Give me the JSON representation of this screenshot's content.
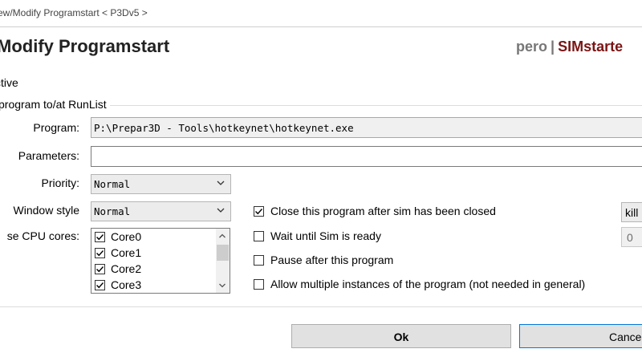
{
  "window": {
    "title": "ew/Modify Programstart < P3Dv5 >"
  },
  "header": {
    "title": "Modify Programstart",
    "brand_user": "pero",
    "brand_separator": "|",
    "brand_app": "SIMstarte"
  },
  "form": {
    "active_label": "ctive",
    "group_title": "program to/at RunList",
    "program_label": "Program:",
    "program_value": "P:\\Prepar3D - Tools\\hotkeynet\\hotkeynet.exe",
    "parameters_label": "Parameters:",
    "parameters_value": "",
    "priority_label": "Priority:",
    "priority_value": "Normal",
    "window_style_label": "Window style",
    "window_style_value": "Normal",
    "cpu_label": "se CPU cores:",
    "cpu_cores": [
      {
        "label": "Core0",
        "checked": true
      },
      {
        "label": "Core1",
        "checked": true
      },
      {
        "label": "Core2",
        "checked": true
      },
      {
        "label": "Core3",
        "checked": true
      }
    ],
    "options": [
      {
        "label": "Close this program after sim has been closed",
        "checked": true
      },
      {
        "label": "Wait until Sim is ready",
        "checked": false
      },
      {
        "label": "Pause after this program",
        "checked": false
      },
      {
        "label": "Allow multiple instances of the program (not needed in general)",
        "checked": false
      }
    ],
    "close_method_value": "kill",
    "wait_value": "0"
  },
  "buttons": {
    "ok_label": "Ok",
    "cancel_label": "Cance"
  },
  "colors": {
    "brand_app": "#7a1515",
    "brand_user": "#777777",
    "default_button_border": "#0078d7"
  }
}
